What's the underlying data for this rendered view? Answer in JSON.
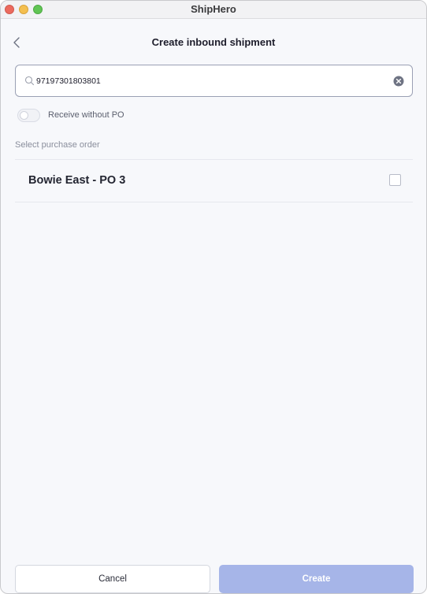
{
  "window": {
    "app_title": "ShipHero"
  },
  "header": {
    "back_icon": "chevron-left-icon",
    "title": "Create inbound shipment"
  },
  "search": {
    "icon": "search-icon",
    "value": "97197301803801",
    "clear_icon": "clear-circle-icon"
  },
  "receive_toggle": {
    "label": "Receive without PO",
    "checked": false
  },
  "purchase_orders": {
    "section_label": "Select purchase order",
    "items": [
      {
        "name": "Bowie East - PO 3",
        "selected": false
      }
    ]
  },
  "footer": {
    "cancel_label": "Cancel",
    "create_label": "Create",
    "create_color": "#a6b5e8"
  }
}
